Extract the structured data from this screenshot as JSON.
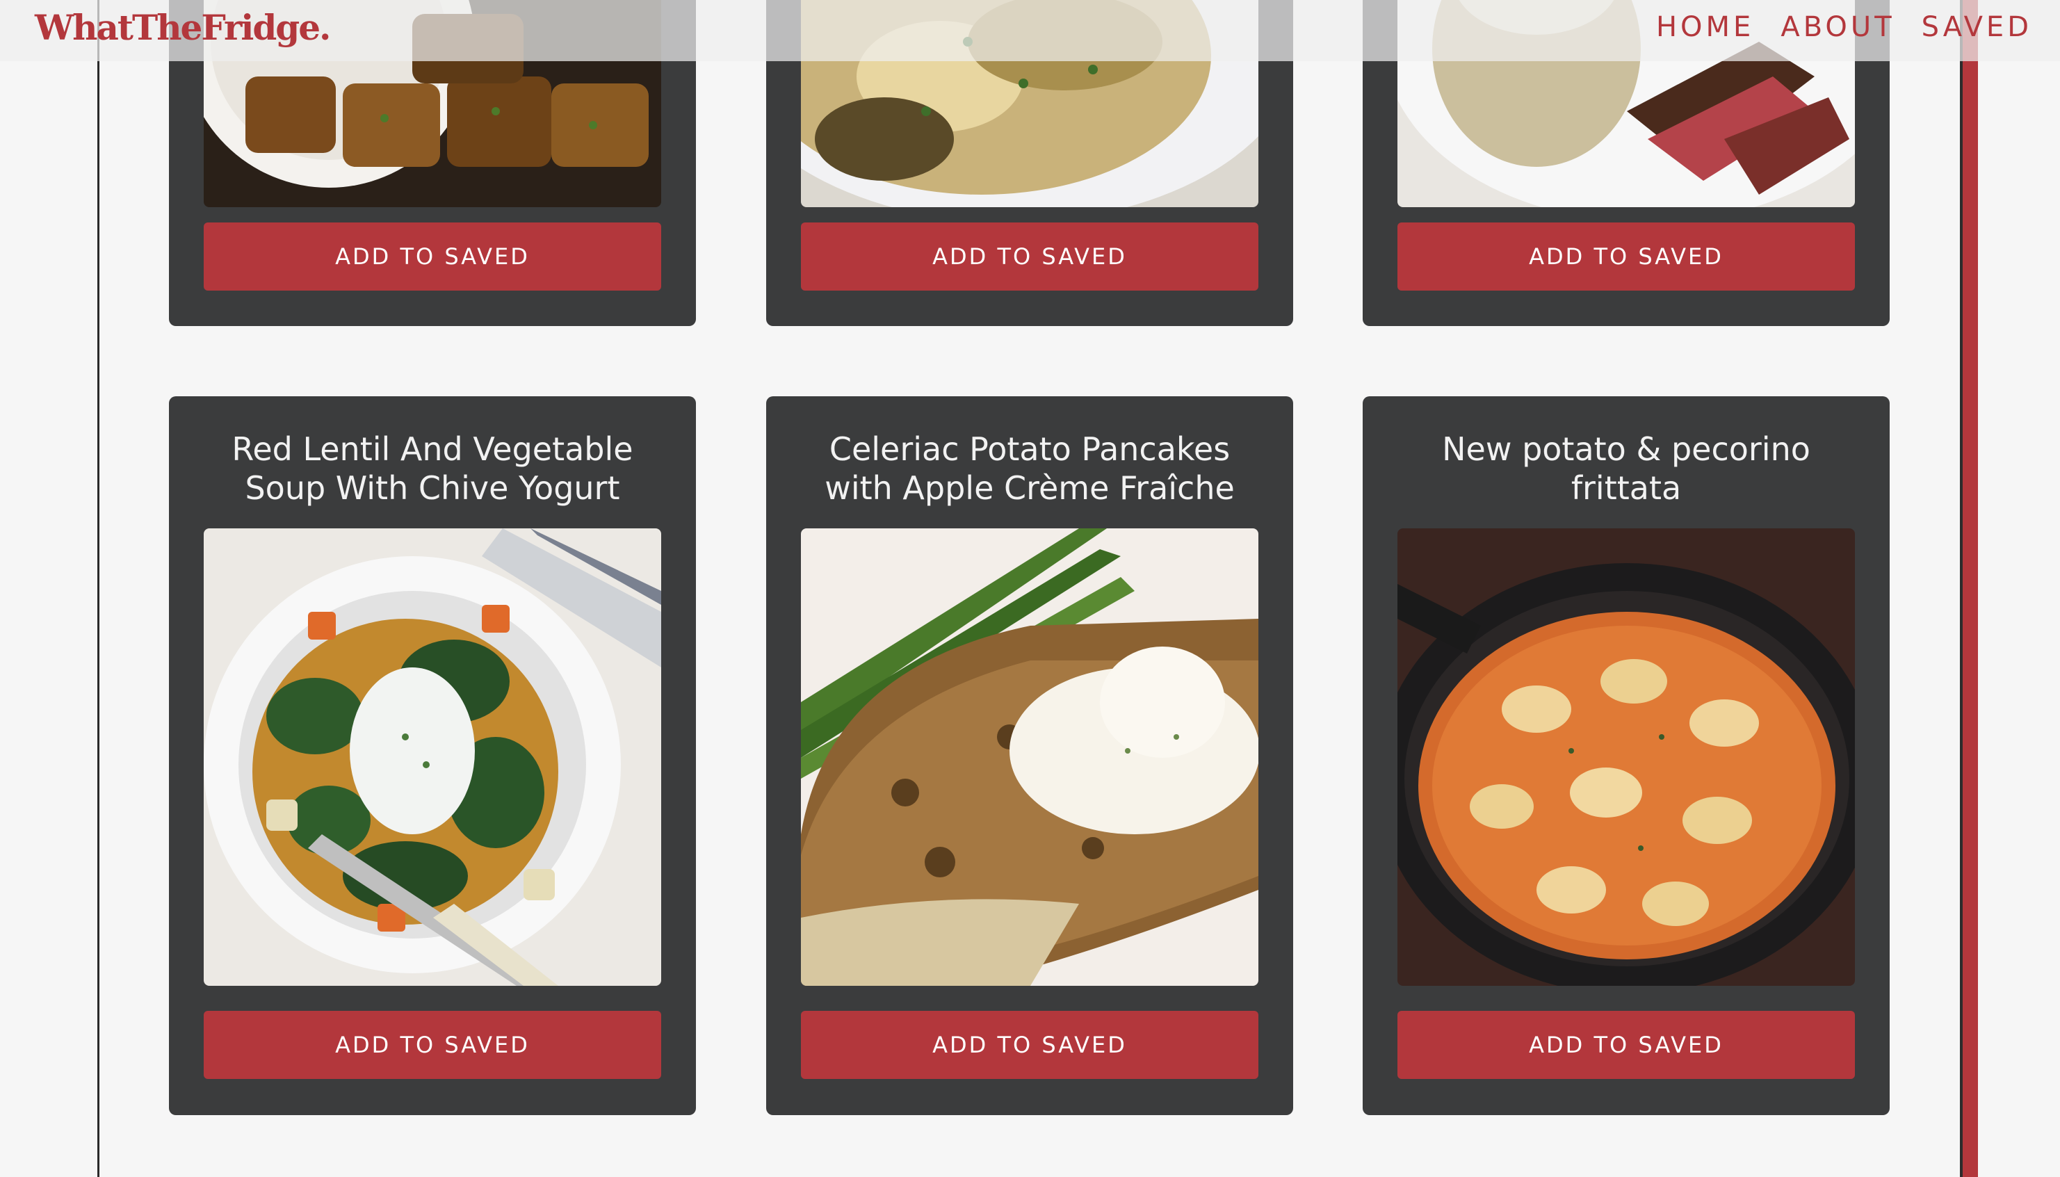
{
  "header": {
    "logo": "WhatTheFridge.",
    "nav": [
      "HOME",
      "ABOUT",
      "SAVED"
    ]
  },
  "colors": {
    "accent": "#b3373c",
    "card_bg": "#3b3c3d",
    "page_bg": "#f6f6f6"
  },
  "cards_top_row": [
    {
      "button": "ADD TO SAVED",
      "image": "fritters-on-doily-image"
    },
    {
      "button": "ADD TO SAVED",
      "image": "scramble-in-bowl-image"
    },
    {
      "button": "ADD TO SAVED",
      "image": "sliced-steak-potato-image"
    }
  ],
  "cards_bottom_row": [
    {
      "title_line1": "Red Lentil And Vegetable",
      "title_line2": "Soup With Chive Yogurt",
      "button": "ADD TO SAVED",
      "image": "lentil-soup-image"
    },
    {
      "title_line1": "Celeriac Potato Pancakes",
      "title_line2": "with Apple Crème Fraîche",
      "button": "ADD TO SAVED",
      "image": "potato-pancake-image"
    },
    {
      "title_line1": "New potato & pecorino",
      "title_line2": "frittata",
      "button": "ADD TO SAVED",
      "image": "frittata-pan-image"
    }
  ]
}
